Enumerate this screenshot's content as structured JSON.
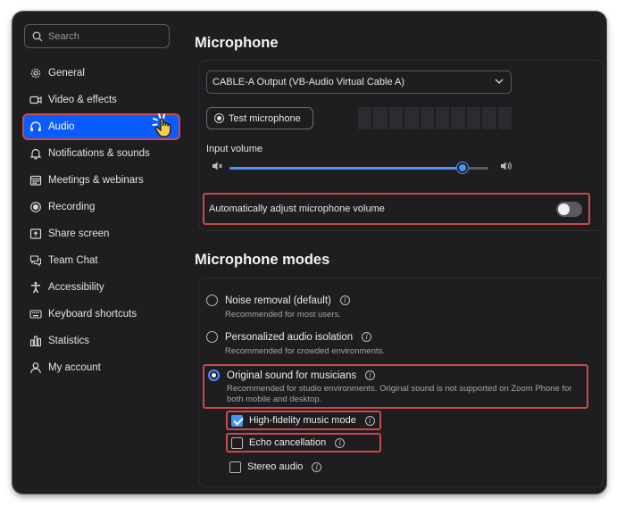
{
  "search": {
    "placeholder": "Search"
  },
  "sidebar": {
    "items": [
      {
        "label": "General",
        "icon": "gear-icon"
      },
      {
        "label": "Video & effects",
        "icon": "video-camera-icon"
      },
      {
        "label": "Audio",
        "icon": "headphones-icon",
        "active": true
      },
      {
        "label": "Notifications & sounds",
        "icon": "bell-icon"
      },
      {
        "label": "Meetings & webinars",
        "icon": "calendar-icon"
      },
      {
        "label": "Recording",
        "icon": "record-icon"
      },
      {
        "label": "Share screen",
        "icon": "share-screen-icon"
      },
      {
        "label": "Team Chat",
        "icon": "chat-icon"
      },
      {
        "label": "Accessibility",
        "icon": "accessibility-icon"
      },
      {
        "label": "Keyboard shortcuts",
        "icon": "keyboard-icon"
      },
      {
        "label": "Statistics",
        "icon": "bar-chart-icon"
      },
      {
        "label": "My account",
        "icon": "user-icon"
      }
    ]
  },
  "microphone": {
    "title": "Microphone",
    "device": "CABLE-A Output (VB-Audio Virtual Cable A)",
    "test_label": "Test microphone",
    "input_volume_label": "Input volume",
    "input_volume_fraction": 0.9,
    "auto_adjust_label": "Automatically adjust microphone volume",
    "auto_adjust_on": false
  },
  "modes": {
    "title": "Microphone modes",
    "noise": {
      "label": "Noise removal (default)",
      "desc": "Recommended for most users."
    },
    "personalized": {
      "label": "Personalized audio isolation",
      "desc": "Recommended for crowded environments."
    },
    "musicians": {
      "label": "Original sound for musicians",
      "desc": "Recommended for studio environments. Original sound is not supported on Zoom Phone for both mobile and desktop.",
      "selected": true
    },
    "hifi": {
      "label": "High-fidelity music mode",
      "checked": true
    },
    "echo": {
      "label": "Echo cancellation",
      "checked": false
    },
    "stereo": {
      "label": "Stereo audio",
      "checked": false
    }
  },
  "colors": {
    "accent": "#0b5cff",
    "highlight": "#c94a4a",
    "background": "#1e1e21"
  }
}
